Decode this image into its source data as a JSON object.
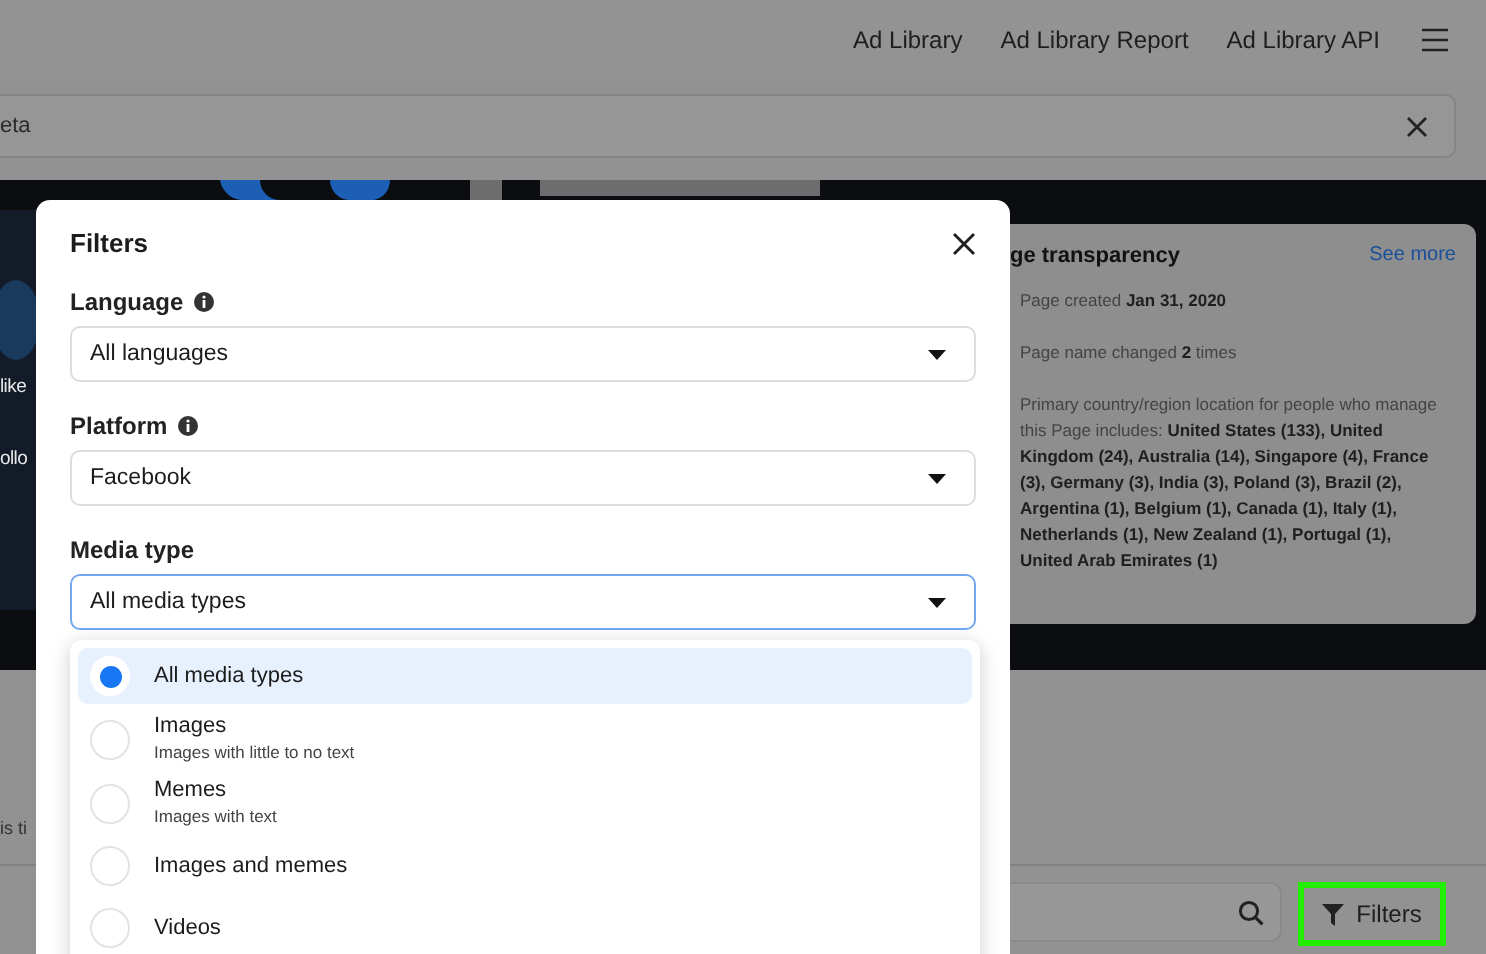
{
  "nav": {
    "links": [
      "Ad Library",
      "Ad Library Report",
      "Ad Library API"
    ]
  },
  "search": {
    "value": "eta"
  },
  "banner": {
    "kind": "picture",
    "fragments": [
      "like",
      "ollo"
    ]
  },
  "transparency": {
    "title": "ge transparency",
    "link": "See more",
    "lines": [
      "Page created **Jan 31, 2020**",
      "Page name changed **2** times",
      "Primary country/region location for people who manage this Page includes: **United States (133), United Kingdom (24), Australia (14), Singapore (4), France (3), Germany (3), India (3), Poland (3), Brazil (2), Argentina (1), Belgium (1), Canada (1), Italy (1), Netherlands (1), New Zealand (1), Portugal (1), United Arab Emirates (1)**"
    ]
  },
  "lower": {
    "fragment": "is ti",
    "filters_button": "Filters",
    "filters_highlighted": true
  },
  "modal": {
    "title": "Filters",
    "fields": [
      {
        "label": "Language",
        "info": true,
        "value": "All languages",
        "focused": false
      },
      {
        "label": "Platform",
        "info": true,
        "value": "Facebook",
        "focused": false
      },
      {
        "label": "Media type",
        "info": false,
        "value": "All media types",
        "focused": true
      }
    ],
    "options": [
      {
        "label": "All media types",
        "selected": true
      },
      {
        "label": "Images",
        "description": "Images with little to no text",
        "selected": false
      },
      {
        "label": "Memes",
        "description": "Images with text",
        "selected": false
      },
      {
        "label": "Images and memes",
        "selected": false
      },
      {
        "label": "Videos",
        "selected": false
      }
    ]
  }
}
